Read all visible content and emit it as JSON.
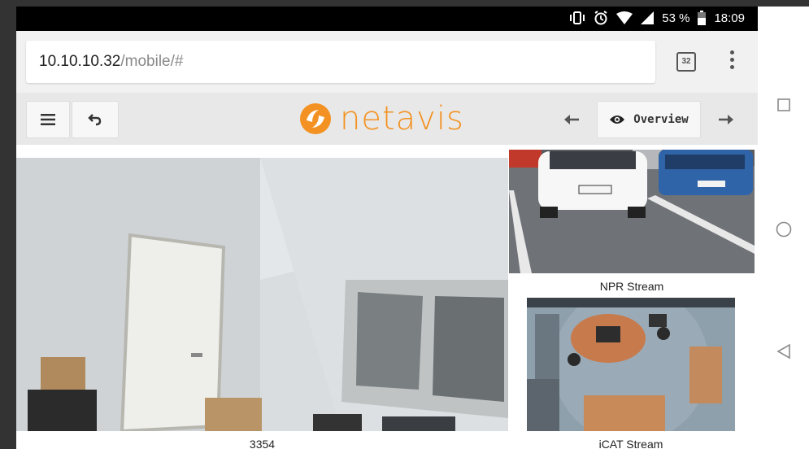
{
  "status_bar": {
    "battery": "53 %",
    "time": "18:09"
  },
  "address_bar": {
    "host": "10.10.10.32",
    "path": "/mobile/#",
    "tab_count": "32"
  },
  "toolbar": {
    "logo_text": "netavis",
    "overview_label": "Overview"
  },
  "cameras": [
    {
      "caption": "3354"
    },
    {
      "caption": "NPR Stream"
    },
    {
      "caption": "iCAT Stream"
    }
  ],
  "colors": {
    "brand": "#f39222",
    "status_bar": "#000000",
    "toolbar": "#e8e8e8"
  }
}
